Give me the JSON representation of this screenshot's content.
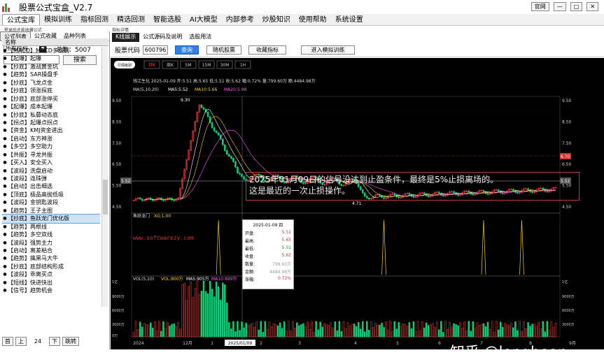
{
  "window": {
    "title": "股票公式宝盒_V2.7",
    "buttons": [
      "官网",
      "—",
      "□",
      "✕"
    ]
  },
  "menu": [
    "公式宝库",
    "模拟训练",
    "指标回测",
    "精选回测",
    "智能选股",
    "AI大模型",
    "内部参考",
    "炒股知识",
    "使用帮助",
    "系统设置"
  ],
  "notice": "·登录后才能收藏公式",
  "left": {
    "tabs": [
      "公式列表",
      "公式收藏",
      "品种列表"
    ],
    "filter": "所有指标",
    "total": "总数：5007",
    "search_label": "搜索",
    "column": "名称",
    "items": [
      "【MACD】MACD多级别",
      "【起爆】起爆",
      "【抄底】激战黄金坑",
      "【趋势】SAR操盘手",
      "【抄底】飞龙点金",
      "【抄底】领涨探底",
      "【抄底】底部涨停买",
      "【起爆】成本起爆",
      "【抄底】私募动态底",
      "【拐点】起爆点拐点",
      "【资金】KMJ资金进出",
      "【启动】东方神涨",
      "【多空】多空助力",
      "【共振】寻龙共振",
      "【买入】安全买入",
      "【波段】洗盘启动",
      "【波段】连珠弹",
      "【启动】出击细选",
      "【顶底】极品高抛低吸",
      "【波段】金钥匙波段",
      "【趋势】王子主图",
      "【抄底】鱼跃龙门优化版",
      "【趋势】两根线",
      "【趋势】多空双线",
      "【波段】强势主力",
      "【启动】离差粘合",
      "【趋势】擒黑马大牛",
      "【抄底】底部结构形成",
      "【波段】乖离买点",
      "【短线】快进快出",
      "【信号】趋势机会"
    ],
    "selected_index": 21,
    "pager": {
      "first": "首",
      "prev": "上",
      "page": "24",
      "next": "下",
      "jump": "跳转"
    }
  },
  "right": {
    "title": "指标详情",
    "tabs": [
      "K线展示",
      "公式源码及说明",
      "选股用法"
    ],
    "code_label": "股票代码",
    "code": "600796",
    "buttons": [
      "查询",
      "随机股票",
      "收藏指标",
      "进入模拟训练"
    ],
    "period_label": "行情级别",
    "periods": [
      "日K",
      "周K",
      "5M",
      "15M",
      "30M",
      "1H"
    ]
  },
  "chart": {
    "info": [
      "钱江生化",
      "2025-01-09",
      "开:5.51",
      "高:5.65",
      "低:5.51",
      "收:5.62",
      "幅:0.72%",
      "量:799.60万",
      "额:4484.98万"
    ],
    "ma": [
      "MA(5,10,20)",
      "MA5:5.52",
      "MA10:5.66",
      "MA20:5.98"
    ],
    "yticks": [
      "9.50",
      "8.50",
      "7.50",
      "6.50",
      "5.50",
      "4.50"
    ],
    "price_high": "9.30",
    "price_low": "4.71",
    "price_cur": "5.52",
    "price_right": "6.70",
    "ind_label": "鱼跃龙门",
    "ind_value": "XG:1.00",
    "vol": [
      "VOL(5,10)",
      "VOL:800万",
      "MAS:905万",
      "MA10:899万"
    ],
    "vol_ticks": [
      "1亿",
      "9000万",
      "6000万",
      "3000万",
      "0万"
    ],
    "vol_ticks_right": [
      "1亿",
      "9000万",
      "6000万",
      "3000万"
    ],
    "xlabels": [
      "2024",
      "12月",
      "1",
      "2025/01/09",
      "2",
      "3",
      "4",
      "5",
      "6",
      "7",
      "8",
      "9月"
    ],
    "site": "www.softwarezy.com",
    "annotation": [
      "2025年01月09日的信号没达到止盈条件，最终是5%止损离场的。",
      "这是最近的一次止损操作。"
    ],
    "watermark": "知乎 @longhean",
    "tooltip": {
      "date": "2025-01-09 四",
      "rows": [
        [
          "开盘:",
          "5.51"
        ],
        [
          "最高:",
          "5.65"
        ],
        [
          "最低:",
          "5.51"
        ],
        [
          "收盘:",
          "5.62"
        ],
        [
          "数量:",
          "799.60万"
        ],
        [
          "金额:",
          "4484.98万"
        ],
        [
          "涨幅:",
          "0.72%"
        ]
      ]
    },
    "colors": {
      "up": "#ff3b3b",
      "down": "#00d27a",
      "ma5": "#ffffff",
      "ma10": "#ffd400",
      "ma20": "#ff55ff"
    }
  }
}
